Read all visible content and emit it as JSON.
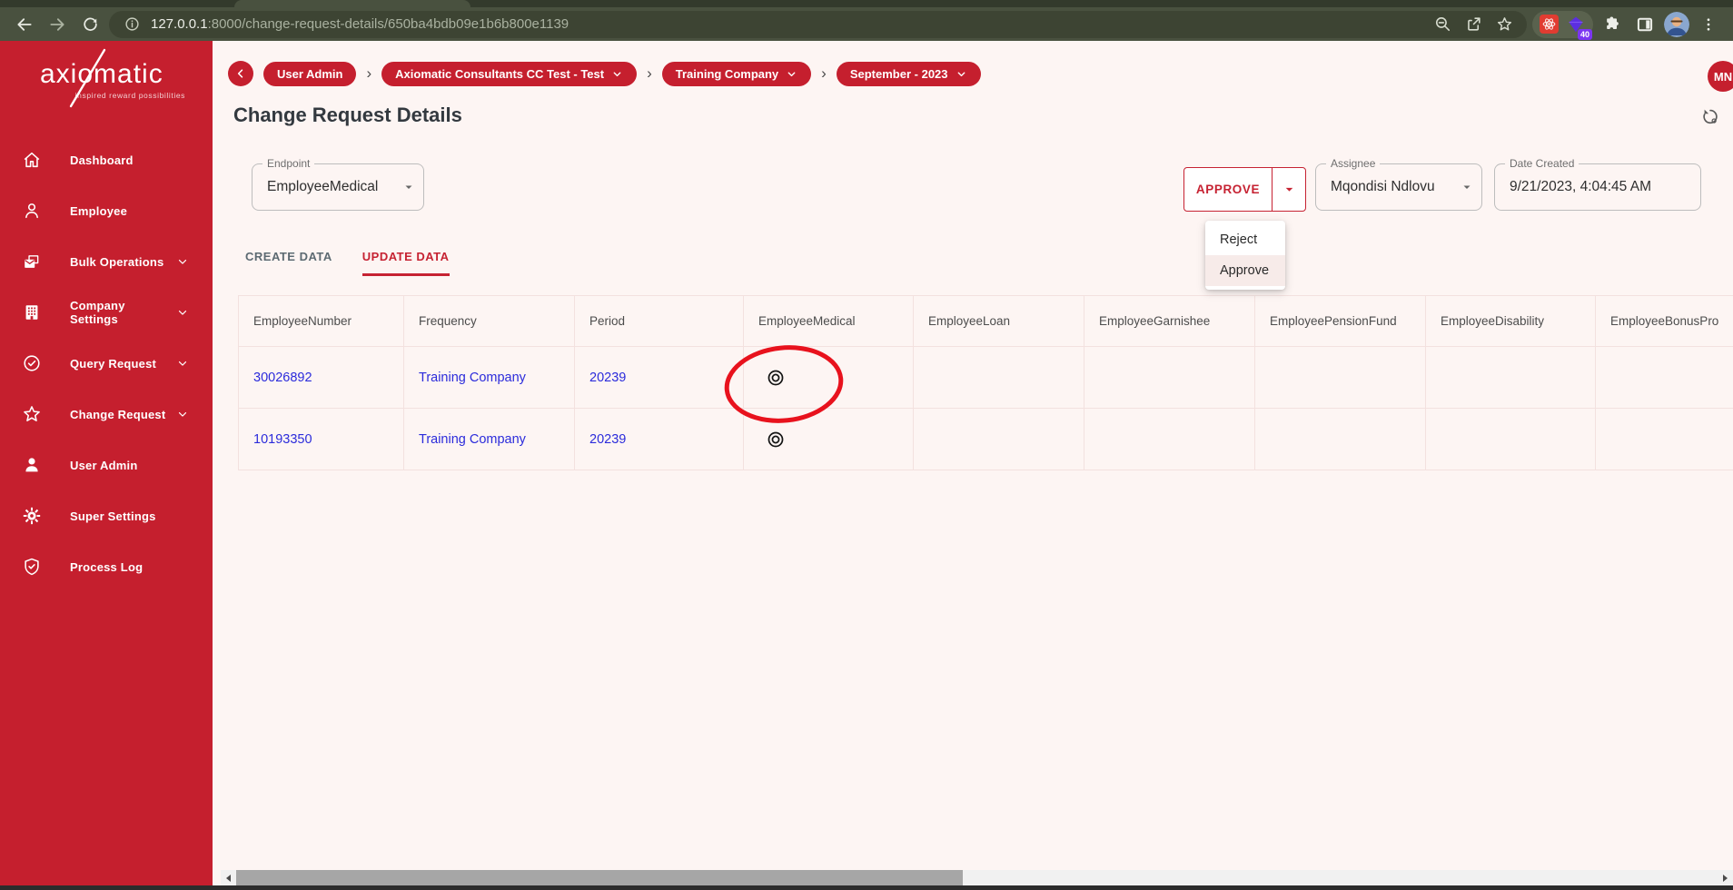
{
  "browser": {
    "url_host": "127.0.0.1",
    "url_rest": ":8000/change-request-details/650ba4bdb09e1b6b800e1139",
    "extensions_badge": "40"
  },
  "sidebar": {
    "logo": "axiomatic",
    "tagline": "inspired reward possibilities",
    "items": [
      {
        "label": "Dashboard",
        "icon": "home-icon",
        "has_chevron": false
      },
      {
        "label": "Employee",
        "icon": "employee-icon",
        "has_chevron": false
      },
      {
        "label": "Bulk Operations",
        "icon": "bulk-operations-icon",
        "has_chevron": true
      },
      {
        "label": "Company Settings",
        "icon": "company-settings-icon",
        "has_chevron": true
      },
      {
        "label": "Query Request",
        "icon": "query-request-icon",
        "has_chevron": true
      },
      {
        "label": "Change Request",
        "icon": "change-request-icon",
        "has_chevron": true
      },
      {
        "label": "User Admin",
        "icon": "user-admin-icon",
        "has_chevron": false
      },
      {
        "label": "Super Settings",
        "icon": "super-settings-icon",
        "has_chevron": false
      },
      {
        "label": "Process Log",
        "icon": "process-log-icon",
        "has_chevron": false
      }
    ]
  },
  "breadcrumb": {
    "separator": "›",
    "items": [
      {
        "label": "User Admin",
        "dropdown": false
      },
      {
        "label": "Axiomatic Consultants CC Test - Test",
        "dropdown": true
      },
      {
        "label": "Training Company",
        "dropdown": true
      },
      {
        "label": "September - 2023",
        "dropdown": true
      }
    ]
  },
  "user": {
    "initials": "MN"
  },
  "page": {
    "title": "Change Request Details"
  },
  "controls": {
    "endpoint": {
      "label": "Endpoint",
      "value": "EmployeeMedical"
    },
    "approve_button": "APPROVE",
    "approve_menu": [
      "Reject",
      "Approve"
    ],
    "approve_menu_selected": "Approve",
    "assignee": {
      "label": "Assignee",
      "value": "Mqondisi Ndlovu"
    },
    "date_created": {
      "label": "Date Created",
      "value": "9/21/2023, 4:04:45 AM"
    }
  },
  "tabs": [
    {
      "label": "CREATE DATA",
      "active": false
    },
    {
      "label": "UPDATE DATA",
      "active": true
    }
  ],
  "table": {
    "columns": [
      "EmployeeNumber",
      "Frequency",
      "Period",
      "EmployeeMedical",
      "EmployeeLoan",
      "EmployeeGarnishee",
      "EmployeePensionFund",
      "EmployeeDisability",
      "EmployeeBonusPro"
    ],
    "rows": [
      {
        "employee_number": "30026892",
        "frequency": "Training Company",
        "period": "20239",
        "medical_icon": "double-circle-view-icon",
        "annotated": true
      },
      {
        "employee_number": "10193350",
        "frequency": "Training Company",
        "period": "20239",
        "medical_icon": "double-circle-view-icon",
        "annotated": false
      }
    ]
  },
  "colors": {
    "brand_red": "#c51f2e",
    "accent_red": "#c62232",
    "annotation_red": "#e8121d",
    "link_blue": "#2b2bdb",
    "page_bg": "#fdf5f3",
    "chrome_bg": "#49513f"
  },
  "icons": {
    "toolbar": [
      "back-icon",
      "forward-icon",
      "reload-icon",
      "info-icon",
      "zoom-out-icon",
      "share-icon",
      "star-icon",
      "react-devtools-icon",
      "gem-extension-icon",
      "puzzle-extensions-icon",
      "side-panel-icon",
      "profile-avatar",
      "kebab-menu-icon"
    ],
    "page": [
      "sync-settings-icon",
      "double-circle-view-icon",
      "annotation-ellipse"
    ]
  }
}
